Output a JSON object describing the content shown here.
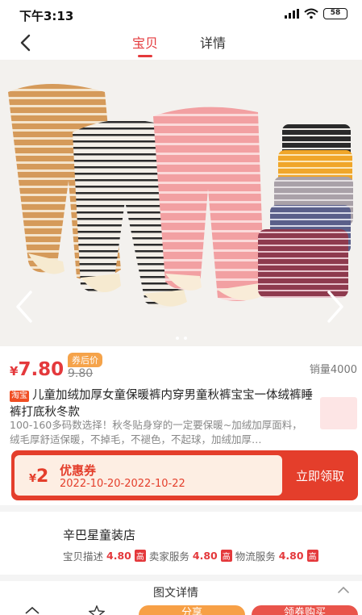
{
  "status": {
    "time": "下午3:13",
    "battery": "58"
  },
  "nav": {
    "tabs": [
      "宝贝",
      "详情"
    ]
  },
  "price": {
    "currency": "¥",
    "amount": "7.80",
    "after_label": "券后价",
    "original": "9.80",
    "sales": "销量4000"
  },
  "product": {
    "tag": "淘宝",
    "title": "儿童加绒加厚女童保暖裤内穿男童秋裤宝宝一体绒裤睡裤打底秋冬款",
    "desc": "100-160多码数选择！秋冬贴身穿的一定要保暖~加绒加厚面料，绒毛厚舒适保暖，不掉毛，不褪色，不起球，加绒加厚…"
  },
  "coupon": {
    "currency": "¥",
    "amount": "2",
    "title": "优惠券",
    "dates": "2022-10-20-2022-10-22",
    "button": "立即领取"
  },
  "store": {
    "name": "辛巴星童装店",
    "ratings": [
      {
        "label": "宝贝描述",
        "value": "4.80",
        "tag": "高"
      },
      {
        "label": "卖家服务",
        "value": "4.80",
        "tag": "高"
      },
      {
        "label": "物流服务",
        "value": "4.80",
        "tag": "高"
      }
    ]
  },
  "detail": {
    "title": "图文详情"
  },
  "bottom": {
    "share": "分享",
    "buy": "领券购买"
  },
  "colors": {
    "accent": "#e4393c",
    "coupon_bg": "#e43e2b",
    "share_btn": "#f7a046",
    "buy_btn": "#e9544b"
  },
  "icons": [
    "back-icon",
    "arrow-left-icon",
    "arrow-right-icon",
    "home-icon",
    "star-icon",
    "chevron-up-icon"
  ]
}
